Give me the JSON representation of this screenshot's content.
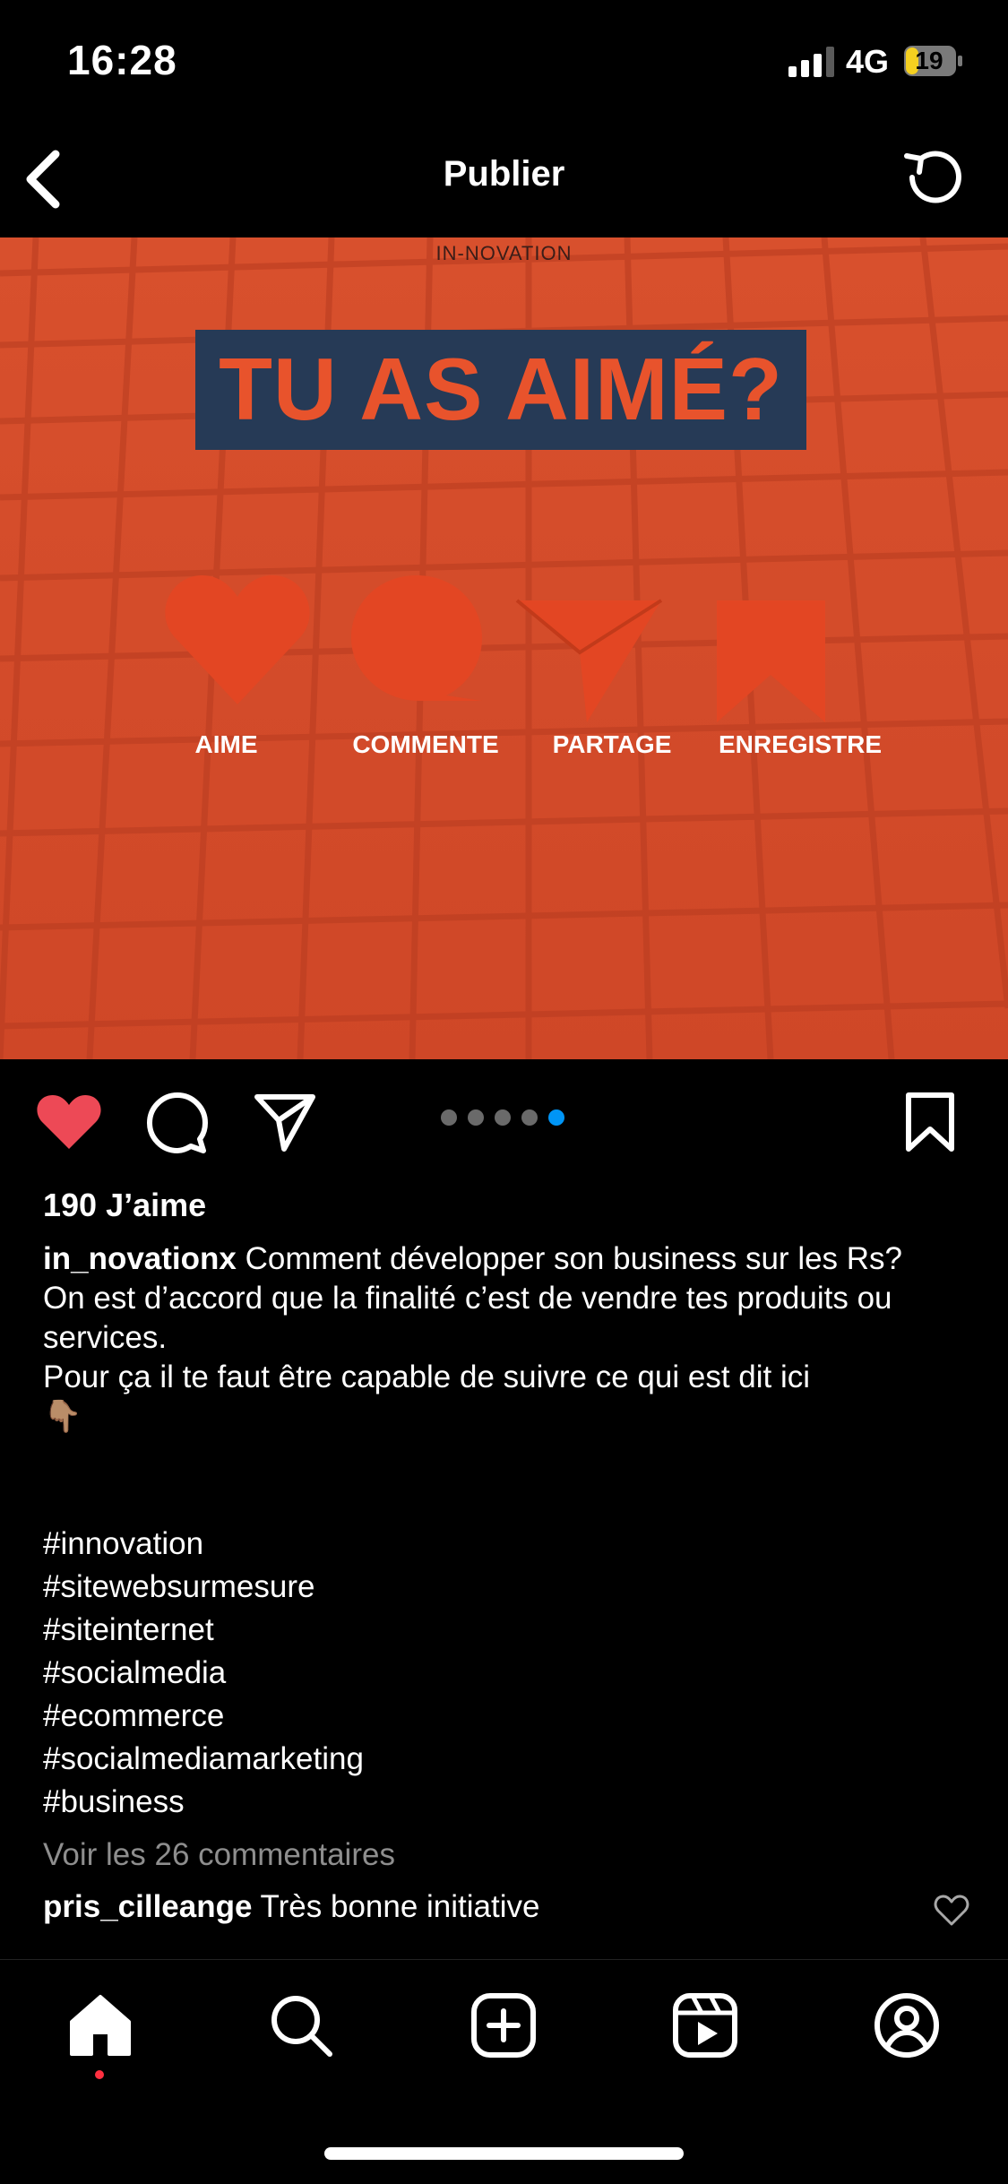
{
  "status_bar": {
    "time": "16:28",
    "network": "4G",
    "battery": "19"
  },
  "header": {
    "title": "Publier",
    "back_icon": "chevron-left-icon",
    "refresh_icon": "refresh-icon"
  },
  "post_image": {
    "brand": "IN-NOVATION",
    "headline": "TU AS AIMÉ?",
    "cta": [
      {
        "label": "AIME",
        "icon": "heart-icon"
      },
      {
        "label": "COMMENTE",
        "icon": "comment-bubble-icon"
      },
      {
        "label": "PARTAGE",
        "icon": "paper-plane-icon"
      },
      {
        "label": "ENREGISTRE",
        "icon": "bookmark-icon"
      }
    ],
    "background_color": "#d24a2a",
    "headline_box_color": "#263a56"
  },
  "carousel": {
    "total": 5,
    "active_index": 4,
    "active_color": "#0095f6"
  },
  "likes": "190 J’aime",
  "caption": {
    "username": "in_novationx",
    "line1": "Comment développer son business sur les Rs?",
    "line2": "On est d’accord que la finalité c’est de vendre tes produits ou services.",
    "line3": "Pour ça il te faut être capable de suivre ce qui est dit ici",
    "emoji": "👇🏽"
  },
  "hashtags": [
    "#innovation",
    "#sitewebsurmesure",
    "#siteinternet",
    "#socialmedia",
    "#ecommerce",
    "#socialmediamarketing",
    "#business"
  ],
  "view_comments": "Voir les 26 commentaires",
  "comment": {
    "username": "pris_cilleange",
    "text": "Très bonne initiative"
  },
  "colors": {
    "like_red": "#ed4956",
    "accent_blue": "#0095f6"
  }
}
